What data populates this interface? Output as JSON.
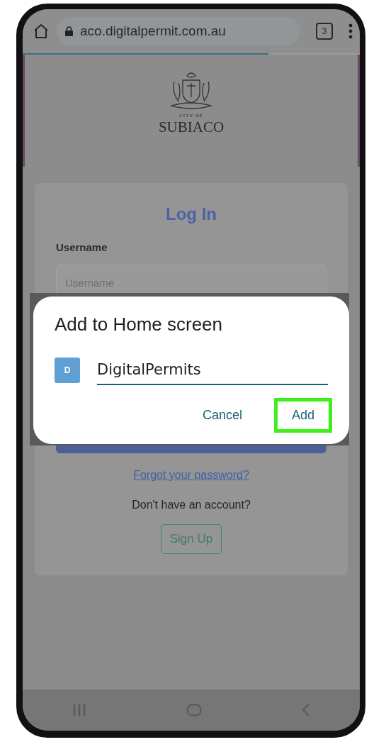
{
  "browser": {
    "url": "aco.digitalpermit.com.au",
    "tab_count": "3",
    "load_progress": {
      "level": 0.73
    }
  },
  "logo": {
    "caption_small": "CITY OF",
    "caption": "SUBIACO"
  },
  "login": {
    "title": "Log In",
    "username_label": "Username",
    "username_placeholder": "Username",
    "forgot_link": "Forgot your password?",
    "signup_prompt": "Don't have an account?",
    "signup_button": "Sign Up"
  },
  "dialog": {
    "title": "Add to Home screen",
    "app_icon_letter": "D",
    "name_value": "DigitalPermits",
    "buttons": [
      {
        "label": "Cancel",
        "highlighted": false
      },
      {
        "label": "Add",
        "highlighted": true
      }
    ]
  }
}
